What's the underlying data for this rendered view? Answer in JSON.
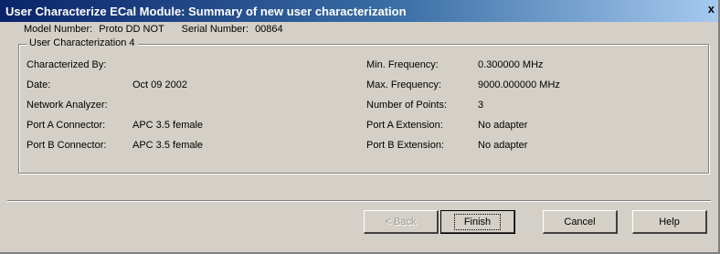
{
  "window": {
    "title": "User Characterize ECal Module: Summary of new user characterization",
    "close_glyph": "x"
  },
  "module": {
    "model_label": "Model Number:",
    "model_value": "Proto DD NOT",
    "serial_label": "Serial Number:",
    "serial_value": "00864"
  },
  "group": {
    "title": "User Characterization 4",
    "left": [
      {
        "label": "Characterized By:",
        "value": ""
      },
      {
        "label": "Date:",
        "value": "Oct 09 2002"
      },
      {
        "label": "Network Analyzer:",
        "value": ""
      },
      {
        "label": "Port A Connector:",
        "value": "APC 3.5 female"
      },
      {
        "label": "Port B Connector:",
        "value": "APC 3.5 female"
      }
    ],
    "right": [
      {
        "label": "Min. Frequency:",
        "value": "0.300000 MHz"
      },
      {
        "label": "Max. Frequency:",
        "value": "9000.000000 MHz"
      },
      {
        "label": "Number of Points:",
        "value": "3"
      },
      {
        "label": "Port A Extension:",
        "value": "No adapter"
      },
      {
        "label": "Port B Extension:",
        "value": "No adapter"
      }
    ]
  },
  "buttons": {
    "back": "< Back",
    "finish": "Finish",
    "cancel": "Cancel",
    "help": "Help"
  }
}
